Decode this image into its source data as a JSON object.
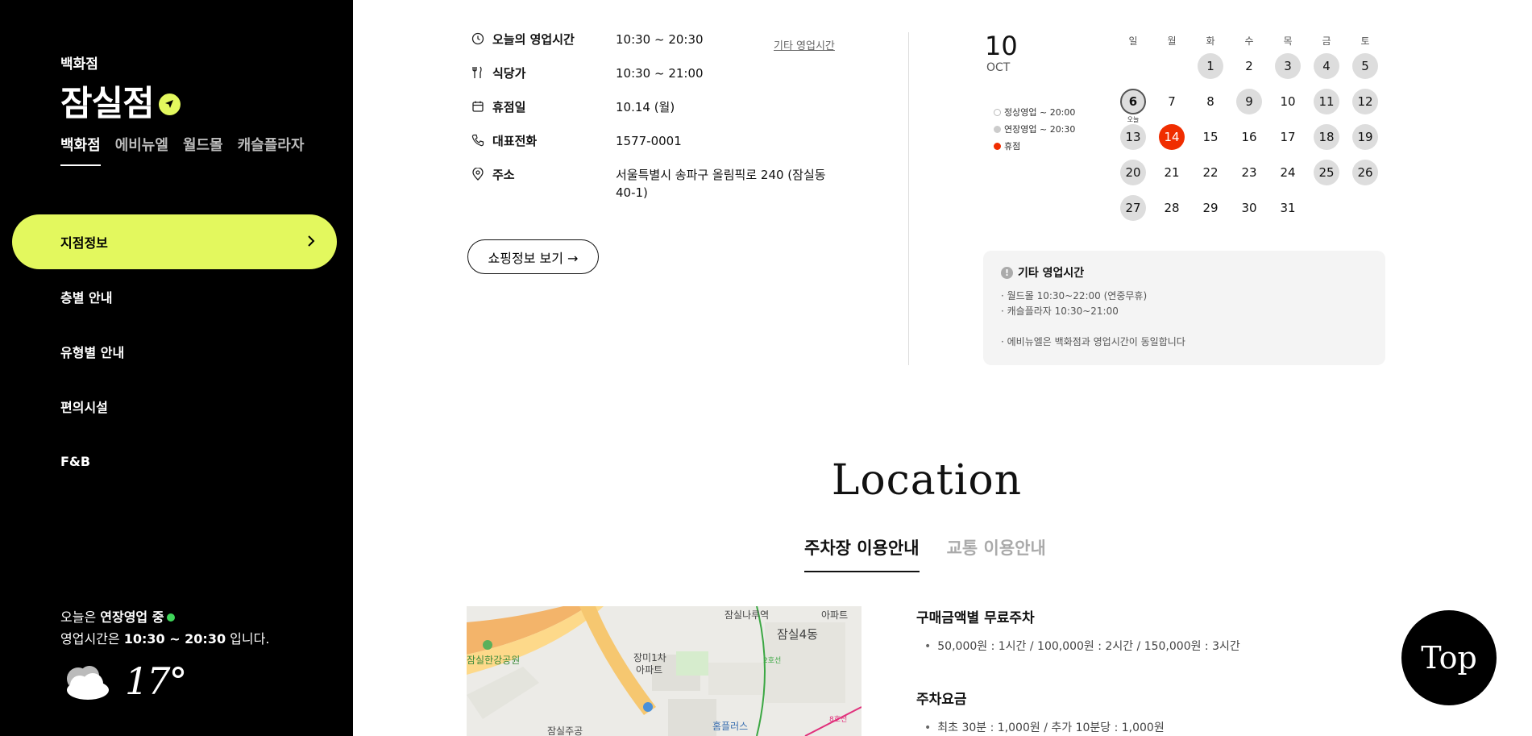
{
  "sidebar": {
    "category": "백화점",
    "store_name": "잠실점",
    "tabs": [
      {
        "label": "백화점",
        "active": true
      },
      {
        "label": "에비뉴엘",
        "active": false
      },
      {
        "label": "월드몰",
        "active": false
      },
      {
        "label": "캐슬플라자",
        "active": false
      }
    ],
    "menu": [
      {
        "label": "지점정보",
        "active": true
      },
      {
        "label": "층별 안내",
        "active": false
      },
      {
        "label": "유형별 안내",
        "active": false
      },
      {
        "label": "편의시설",
        "active": false
      },
      {
        "label": "F&B",
        "active": false
      }
    ],
    "status": {
      "prefix": "오늘은 ",
      "mode": "연장영업 중",
      "hours_prefix": "영업시간은 ",
      "hours": "10:30 ~ 20:30",
      "hours_suffix": " 입니다."
    },
    "weather": {
      "icon": "cloud-icon",
      "temp": "17°"
    }
  },
  "info": {
    "rows": [
      {
        "icon": "clock-icon",
        "label": "오늘의 영업시간",
        "value": "10:30 ~ 20:30"
      },
      {
        "icon": "utensils-icon",
        "label": "식당가",
        "value": "10:30 ~ 21:00"
      },
      {
        "icon": "calendar-icon",
        "label": "휴점일",
        "value": "10.14 (월)"
      },
      {
        "icon": "phone-icon",
        "label": "대표전화",
        "value": "1577-0001"
      },
      {
        "icon": "pin-icon",
        "label": "주소",
        "value": "서울특별시 송파구 올림픽로 240 (잠실동 40-1)"
      }
    ],
    "other_hours_link": "기타 영업시간",
    "shopping_button": "쇼핑정보 보기 →"
  },
  "calendar": {
    "day": "10",
    "month": "OCT",
    "legend": [
      {
        "label": "정상영업 ~ 20:00",
        "color": "#ffffff"
      },
      {
        "label": "연장영업 ~ 20:30",
        "color": "#cccccc"
      },
      {
        "label": "휴점",
        "color": "#f02d00"
      }
    ],
    "weekdays": [
      "일",
      "월",
      "화",
      "수",
      "목",
      "금",
      "토"
    ],
    "today_label": "오늘",
    "cells": [
      {
        "d": "",
        "t": ""
      },
      {
        "d": "",
        "t": ""
      },
      {
        "d": "1",
        "t": "ext"
      },
      {
        "d": "2",
        "t": ""
      },
      {
        "d": "3",
        "t": "ext"
      },
      {
        "d": "4",
        "t": "ext"
      },
      {
        "d": "5",
        "t": "ext"
      },
      {
        "d": "6",
        "t": "today"
      },
      {
        "d": "7",
        "t": ""
      },
      {
        "d": "8",
        "t": ""
      },
      {
        "d": "9",
        "t": "ext"
      },
      {
        "d": "10",
        "t": ""
      },
      {
        "d": "11",
        "t": "ext"
      },
      {
        "d": "12",
        "t": "ext"
      },
      {
        "d": "13",
        "t": "ext"
      },
      {
        "d": "14",
        "t": "closed"
      },
      {
        "d": "15",
        "t": ""
      },
      {
        "d": "16",
        "t": ""
      },
      {
        "d": "17",
        "t": ""
      },
      {
        "d": "18",
        "t": "ext"
      },
      {
        "d": "19",
        "t": "ext"
      },
      {
        "d": "20",
        "t": "ext"
      },
      {
        "d": "21",
        "t": ""
      },
      {
        "d": "22",
        "t": ""
      },
      {
        "d": "23",
        "t": ""
      },
      {
        "d": "24",
        "t": ""
      },
      {
        "d": "25",
        "t": "ext"
      },
      {
        "d": "26",
        "t": "ext"
      },
      {
        "d": "27",
        "t": "ext"
      },
      {
        "d": "28",
        "t": ""
      },
      {
        "d": "29",
        "t": ""
      },
      {
        "d": "30",
        "t": ""
      },
      {
        "d": "31",
        "t": ""
      },
      {
        "d": "",
        "t": ""
      },
      {
        "d": "",
        "t": ""
      }
    ],
    "other_box": {
      "title": "기타 영업시간",
      "lines": [
        "· 월드몰 10:30~22:00 (연중무휴)",
        "· 캐슬플라자 10:30~21:00",
        "",
        "· 에비뉴엘은 백화점과 영업시간이 동일합니다"
      ]
    }
  },
  "location": {
    "title": "Location",
    "tabs": [
      {
        "label": "주차장 이용안내",
        "active": true
      },
      {
        "label": "교통 이용안내",
        "active": false
      }
    ],
    "map_labels": [
      "잠실나루역",
      "잠실4동",
      "장미1차",
      "아파트",
      "잠실한강공원",
      "홈플러스",
      "잠실주공",
      "아파트",
      "2호선",
      "8호선"
    ],
    "parking": {
      "free_title": "구매금액별 무료주차",
      "free_items": "50,000원 : 1시간  /  100,000원 : 2시간  /  150,000원 : 3시간",
      "fee_title": "주차요금",
      "fee_items": "최초 30분 : 1,000원  /  추가 10분당 : 1,000원"
    }
  },
  "top_button": "Top",
  "colors": {
    "accent": "#e3f85e",
    "closed": "#f02d00",
    "open_dot": "#3fd65a"
  }
}
